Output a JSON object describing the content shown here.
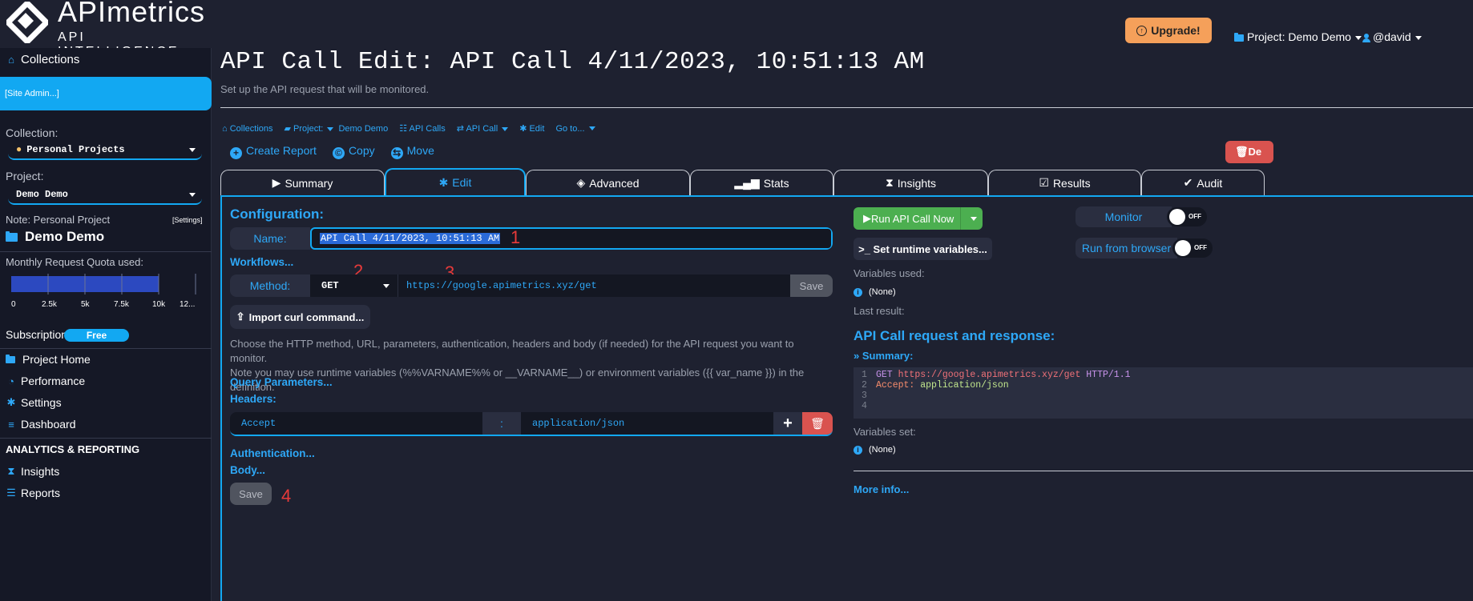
{
  "brand": {
    "name": "APImetrics",
    "tagline": "API INTELLIGENCE"
  },
  "header": {
    "upgrade_label": "Upgrade!",
    "project_menu": "Project: Demo Demo",
    "user_menu": "@david"
  },
  "sidebar": {
    "collections_label": "Collections",
    "site_admin": "[Site Admin...]",
    "collection_label": "Collection:",
    "collection_value": "Personal Projects",
    "project_label": "Project:",
    "settings_link": "[Settings]",
    "project_value": "Demo Demo",
    "note": "Note: Personal Project",
    "project_heading": "Demo Demo",
    "quota_label": "Monthly Request Quota used:",
    "quota_ticks": [
      "0",
      "2.5k",
      "5k",
      "7.5k",
      "10k",
      "12..."
    ],
    "subscription_label": "Subscription:",
    "subscription_value": "Free",
    "nav": [
      {
        "label": "Project Home"
      },
      {
        "label": "Performance"
      },
      {
        "label": "Settings"
      },
      {
        "label": "Dashboard"
      }
    ],
    "analytics_heading": "ANALYTICS & REPORTING",
    "analytics_nav": [
      {
        "label": "Insights"
      },
      {
        "label": "Reports"
      }
    ]
  },
  "main": {
    "title": "API Call Edit: API Call 4/11/2023, 10:51:13 AM",
    "subtitle": "Set up the API request that will be monitored.",
    "breadcrumb": {
      "collections": "Collections",
      "project": "Project:",
      "project_name": "Demo Demo",
      "api_calls": "API Calls",
      "api_call": "API Call",
      "edit": "Edit",
      "goto": "Go to..."
    },
    "actions": {
      "create_report": "Create Report",
      "copy": "Copy",
      "move": "Move",
      "delete": "De"
    },
    "tabs": [
      {
        "label": "Summary"
      },
      {
        "label": "Edit"
      },
      {
        "label": "Advanced"
      },
      {
        "label": "Stats"
      },
      {
        "label": "Insights"
      },
      {
        "label": "Results"
      },
      {
        "label": "Audit"
      }
    ],
    "active_tab": "Edit"
  },
  "config": {
    "title": "Configuration:",
    "name_label": "Name:",
    "name_value": "API Call 4/11/2023, 10:51:13 AM",
    "workflows": "Workflows...",
    "method_label": "Method:",
    "method_value": "GET",
    "url_value": "https://google.apimetrics.xyz/get",
    "save_label": "Save",
    "import_label": "Import curl command...",
    "help_line1": "Choose the HTTP method, URL, parameters, authentication, headers and body (if needed) for the API request you want to monitor.",
    "help_line2": "Note you may use runtime variables (%%VARNAME%% or __VARNAME__) or environment variables ({{ var_name }}) in the definition.",
    "query_params": "Query Parameters...",
    "headers_label": "Headers:",
    "header_key": "Accept",
    "header_sep": ":",
    "header_value": "application/json",
    "authentication": "Authentication...",
    "body": "Body...",
    "save_bottom": "Save"
  },
  "annotations": {
    "a1": "1",
    "a2": "2",
    "a3": "3",
    "a4": "4"
  },
  "right": {
    "run_label": "Run API Call Now",
    "runtime_vars_label": ">_ Set runtime variables...",
    "monitor_label": "Monitor",
    "run_browser_label": "Run from browser",
    "toggle_off": "OFF",
    "variables_used_label": "Variables used:",
    "variables_used_value": "(None)",
    "last_result_label": "Last result:",
    "req_title": "API Call request and response:",
    "summary_link": "» Summary:",
    "code": {
      "method": "GET",
      "url": "https://google.apimetrics.xyz/get",
      "proto": "HTTP/1.1",
      "hdr_key": "Accept:",
      "hdr_val": "application/json"
    },
    "variables_set_label": "Variables set:",
    "variables_set_value": "(None)",
    "more_info": "More info..."
  },
  "colors": {
    "accent": "#12a8f2",
    "run_green": "#4caf50",
    "danger": "#d9534f",
    "upgrade": "#f5a05a"
  },
  "quota": {
    "used_fraction": 0.8
  }
}
